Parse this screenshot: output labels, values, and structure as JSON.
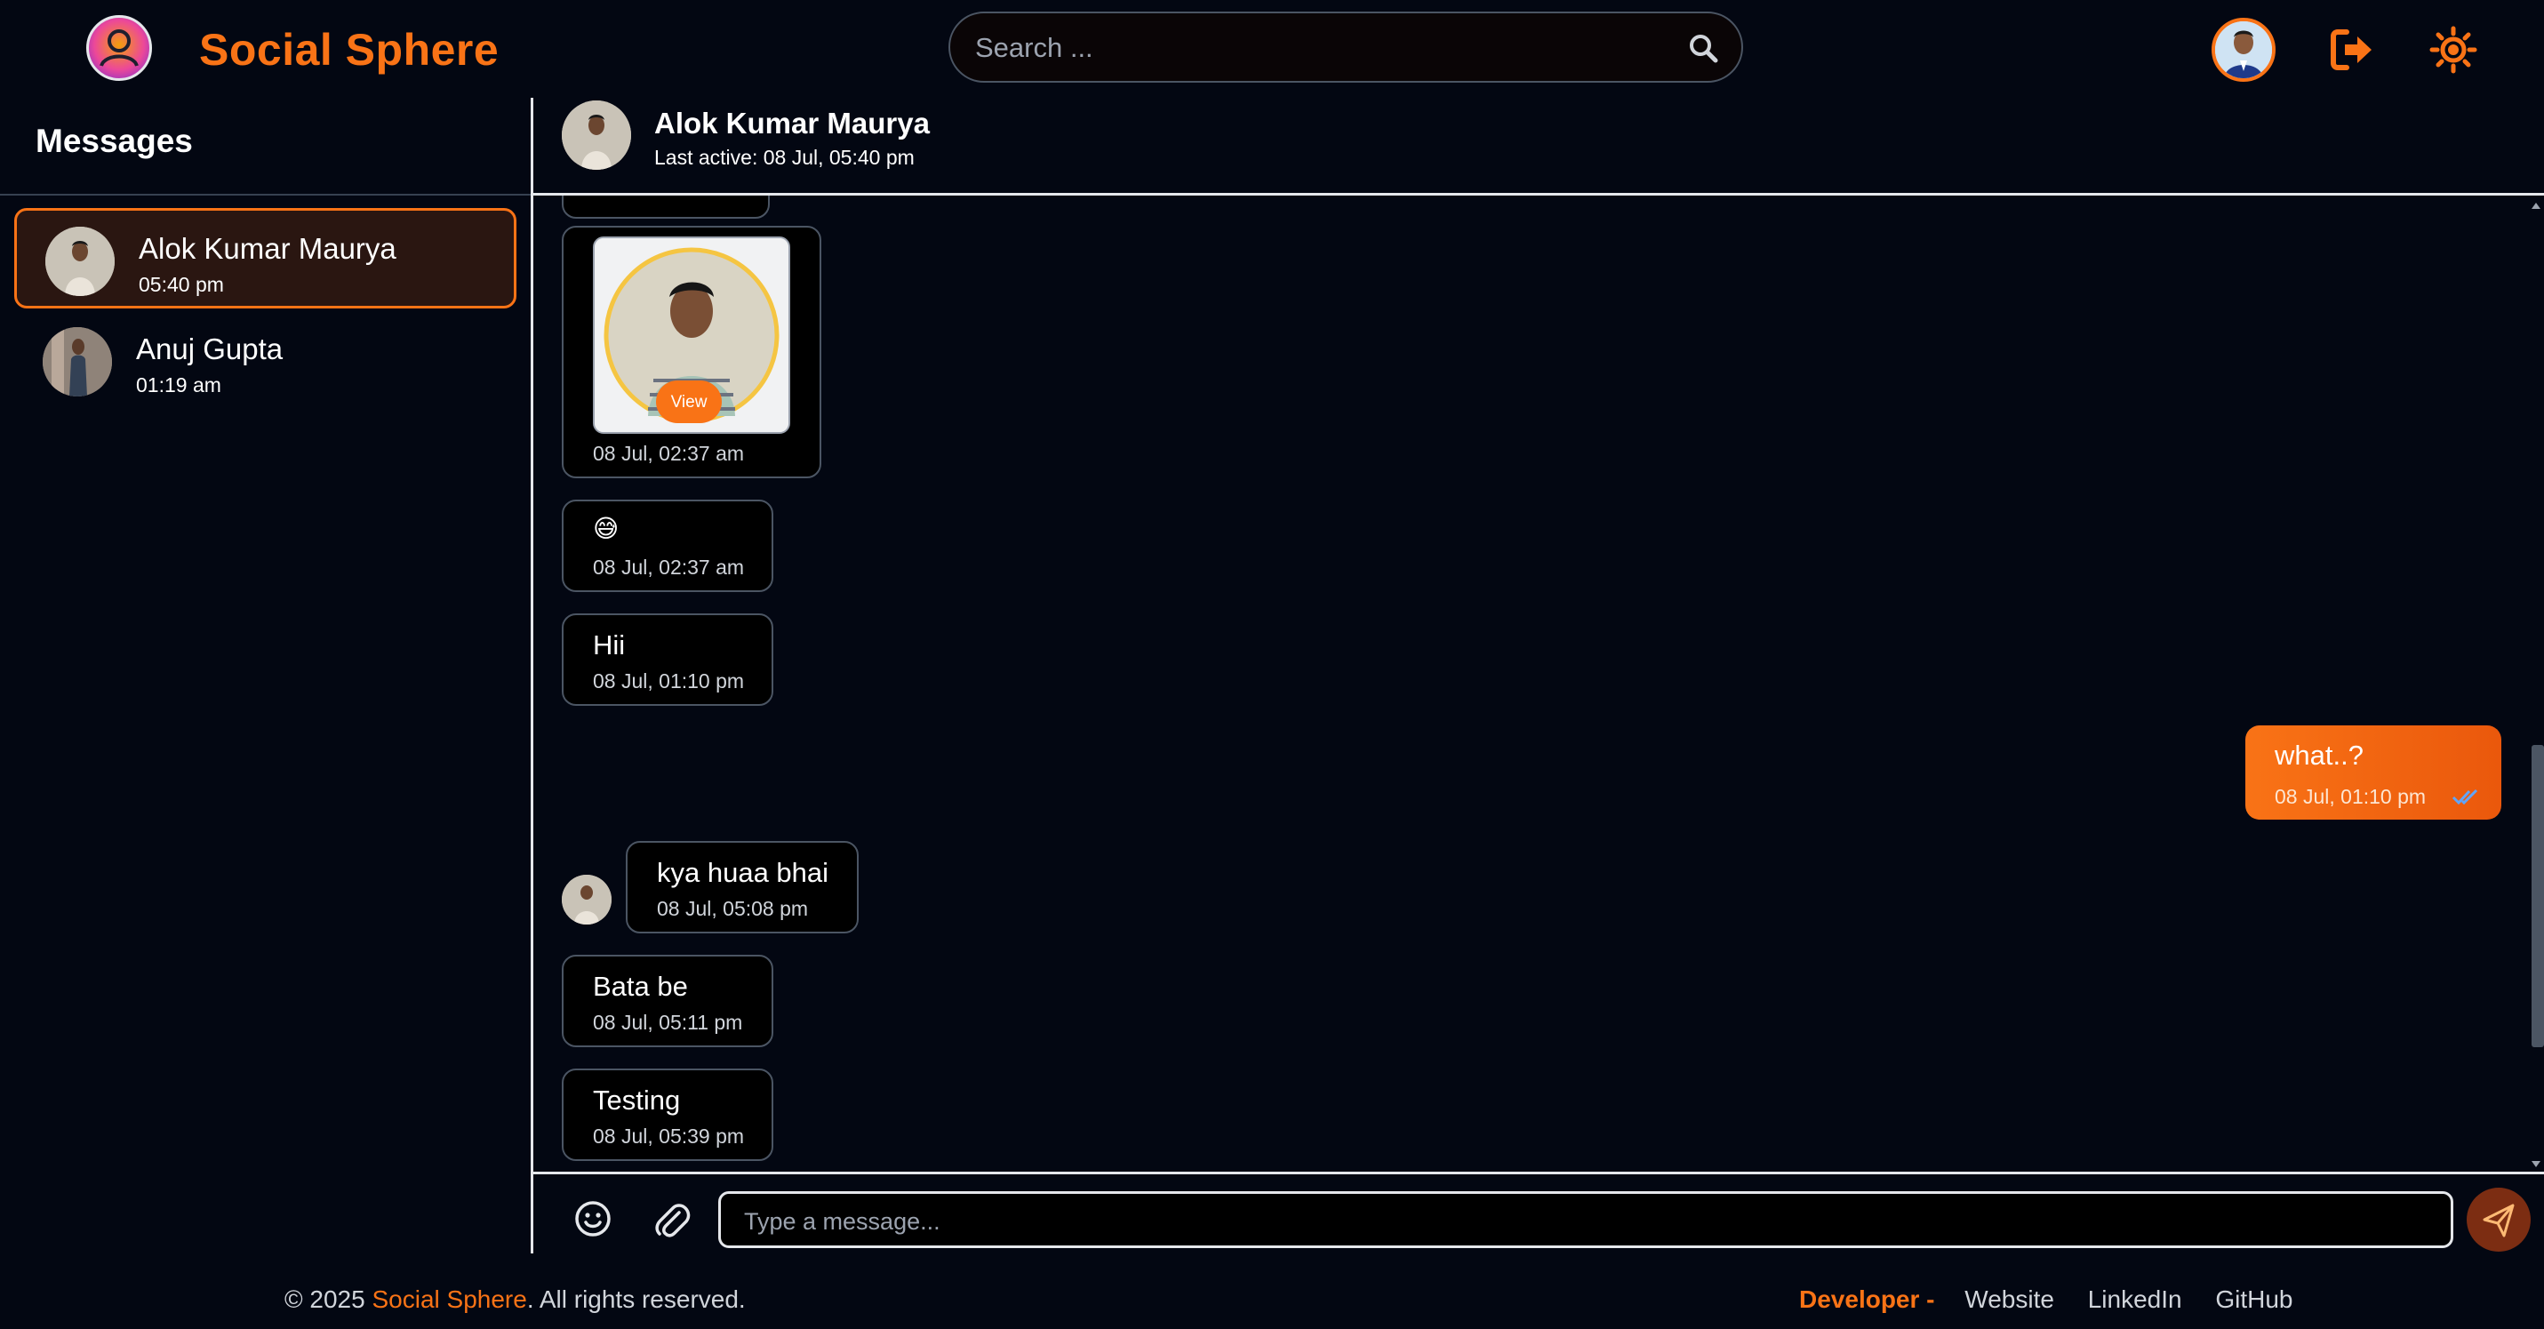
{
  "header": {
    "brand": "Social Sphere",
    "search_placeholder": "Search ..."
  },
  "icons": {
    "logo": "app-logo",
    "search": "search-icon",
    "logout": "logout-icon",
    "theme": "sun-icon",
    "emoji": "smiley-icon",
    "attach": "paperclip-icon",
    "send": "send-icon",
    "read_receipt": "double-check-icon"
  },
  "colors": {
    "accent": "#f97316",
    "background": "#030712",
    "bubble_border": "#4b5563"
  },
  "sidebar": {
    "title": "Messages",
    "chats": [
      {
        "name": "Alok Kumar Maurya",
        "time": "05:40 pm",
        "active": true
      },
      {
        "name": "Anuj Gupta",
        "time": "01:19 am",
        "active": false
      }
    ]
  },
  "chat": {
    "contact_name": "Alok Kumar Maurya",
    "last_active": "Last active: 08 Jul, 05:40 pm",
    "messages": [
      {
        "type": "image",
        "button": "View",
        "time": "08 Jul, 02:37 am",
        "from": "them"
      },
      {
        "type": "text",
        "text": "😅",
        "time": "08 Jul, 02:37 am",
        "from": "them"
      },
      {
        "type": "text",
        "text": "Hii",
        "time": "08 Jul, 01:10 pm",
        "from": "them"
      },
      {
        "type": "text",
        "text": "what..?",
        "time": "08 Jul, 01:10 pm",
        "from": "me"
      },
      {
        "type": "text",
        "text": "kya huaa bhai",
        "time": "08 Jul, 05:08 pm",
        "from": "them"
      },
      {
        "type": "text",
        "text": "Bata be",
        "time": "08 Jul, 05:11 pm",
        "from": "them"
      },
      {
        "type": "text",
        "text": "Testing",
        "time": "08 Jul, 05:39 pm",
        "from": "them"
      }
    ]
  },
  "composer": {
    "placeholder": "Type a message..."
  },
  "footer": {
    "copyright_prefix": "© 2025 ",
    "brand": "Social Sphere",
    "copyright_suffix": ". All rights reserved.",
    "developer_label": "Developer -",
    "links": [
      "Website",
      "LinkedIn",
      "GitHub"
    ]
  }
}
